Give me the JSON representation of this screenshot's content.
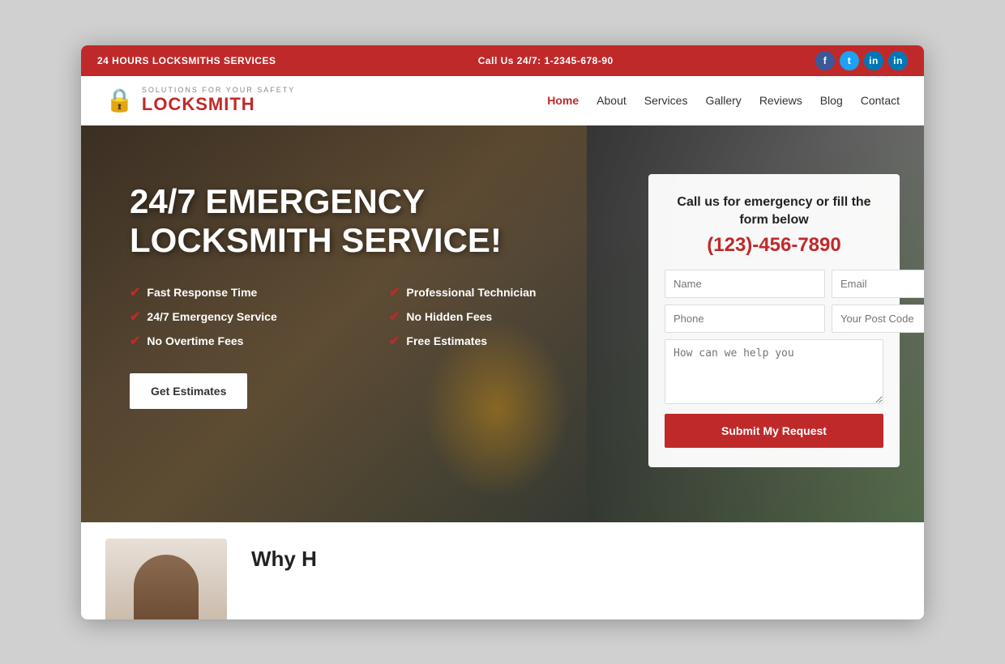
{
  "topbar": {
    "left": "24 HOURS LOCKSMITHS SERVICES",
    "center": "Call Us 24/7: 1-2345-678-90",
    "socials": [
      {
        "name": "facebook",
        "label": "f",
        "class": "fb"
      },
      {
        "name": "twitter",
        "label": "t",
        "class": "tw"
      },
      {
        "name": "linkedin1",
        "label": "in",
        "class": "li"
      },
      {
        "name": "linkedin2",
        "label": "in",
        "class": "li2"
      }
    ]
  },
  "header": {
    "logo_tagline": "SOLUTIONS FOR YOUR SAFETY",
    "logo_name": "LOCKSMITH",
    "nav": [
      {
        "label": "Home",
        "active": true
      },
      {
        "label": "About",
        "active": false
      },
      {
        "label": "Services",
        "active": false
      },
      {
        "label": "Gallery",
        "active": false
      },
      {
        "label": "Reviews",
        "active": false
      },
      {
        "label": "Blog",
        "active": false
      },
      {
        "label": "Contact",
        "active": false
      }
    ]
  },
  "hero": {
    "title": "24/7 EMERGENCY LOCKSMITH SERVICE!",
    "features": [
      "Fast Response Time",
      "Professional Technician",
      "24/7 Emergency Service",
      "No Hidden Fees",
      "No Overtime Fees",
      "Free Estimates"
    ],
    "cta_button": "Get Estimates"
  },
  "form": {
    "title": "Call us for emergency or fill the form below",
    "phone": "(123)-456-7890",
    "fields": {
      "name_placeholder": "Name",
      "email_placeholder": "Email",
      "phone_placeholder": "Phone",
      "postcode_placeholder": "Your Post Code",
      "message_placeholder": "How can we help you"
    },
    "submit_label": "Submit My Request"
  },
  "below_hero": {
    "heading": "Why H",
    "subheading": ""
  }
}
